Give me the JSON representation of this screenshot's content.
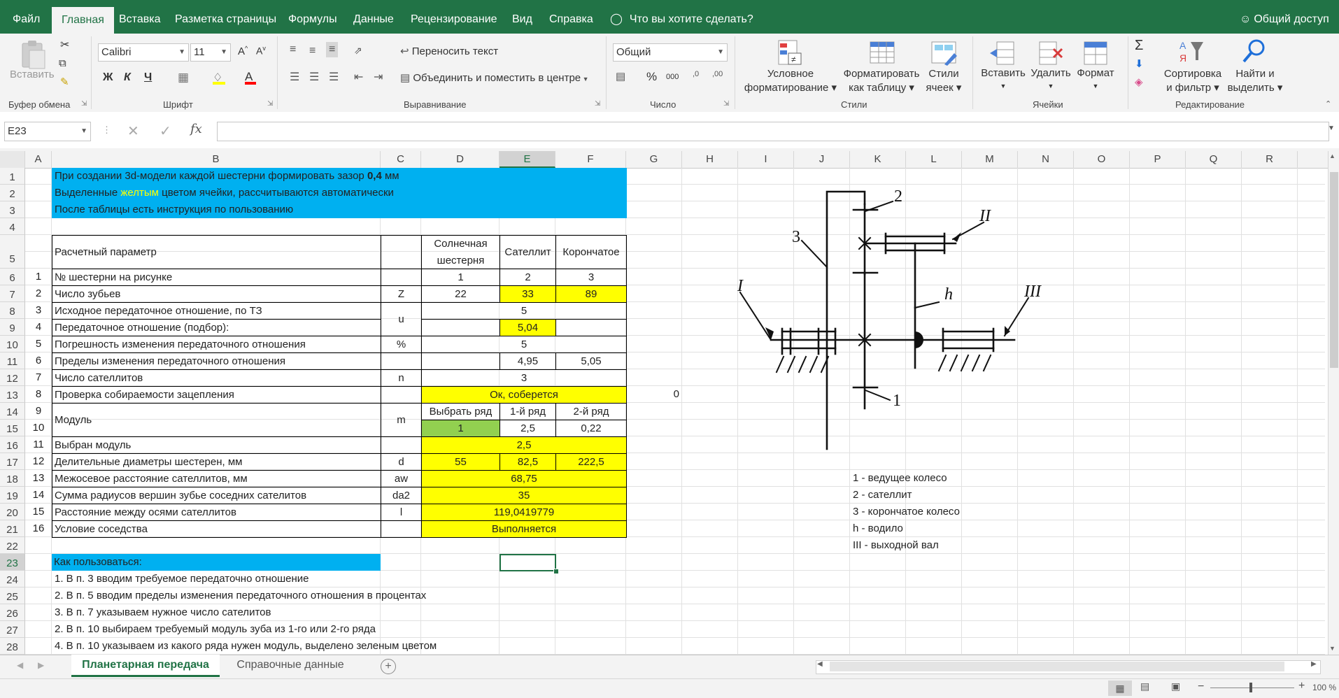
{
  "tabs": [
    "Файл",
    "Главная",
    "Вставка",
    "Разметка страницы",
    "Формулы",
    "Данные",
    "Рецензирование",
    "Вид",
    "Справка"
  ],
  "tell_me": "Что вы хотите сделать?",
  "share": "Общий доступ",
  "ribbon": {
    "clipboard": {
      "paste": "Вставить",
      "label": "Буфер обмена"
    },
    "font": {
      "name": "Calibri",
      "size": "11",
      "bold": "Ж",
      "italic": "К",
      "underline": "Ч",
      "label": "Шрифт"
    },
    "alignment": {
      "wrap": "Переносить текст",
      "merge": "Объединить и поместить в центре",
      "label": "Выравнивание"
    },
    "number": {
      "format": "Общий",
      "percent": "%",
      "thousands": "000",
      "label": "Число"
    },
    "styles": {
      "conditional": [
        "Условное",
        "форматирование"
      ],
      "as_table": [
        "Форматировать",
        "как таблицу"
      ],
      "cell_styles": [
        "Стили",
        "ячеек"
      ],
      "label": "Стили"
    },
    "cells": {
      "insert": "Вставить",
      "delete": "Удалить",
      "format": "Формат",
      "label": "Ячейки"
    },
    "editing": {
      "sum": "Σ",
      "sort": [
        "Сортировка",
        "и фильтр"
      ],
      "find": [
        "Найти и",
        "выделить"
      ],
      "label": "Редактирование"
    }
  },
  "formula_bar": {
    "name_box": "E23",
    "fx": "fx",
    "formula": ""
  },
  "columns": [
    "A",
    "B",
    "C",
    "D",
    "E",
    "F",
    "G",
    "H",
    "I",
    "J",
    "K",
    "L",
    "M",
    "N",
    "O",
    "P",
    "Q",
    "R"
  ],
  "selected_col": "E",
  "selected_row": "23",
  "rows": [
    "1",
    "2",
    "3",
    "4",
    "5",
    "6",
    "7",
    "8",
    "9",
    "10",
    "11",
    "12",
    "13",
    "14",
    "15",
    "16",
    "17",
    "18",
    "19",
    "20",
    "21",
    "22",
    "23",
    "24",
    "25",
    "26",
    "27",
    "28"
  ],
  "info": {
    "line1_pre": "При создании 3d-модели каждой шестерни формировать зазор ",
    "line1_bold": "0,4",
    "line1_post": " мм",
    "line2_pre": "Выделенные ",
    "line2_yellow": "желтым",
    "line2_post": " цветом ячейки, рассчитываются автоматически",
    "line3": "После таблицы есть инструкция по пользованию"
  },
  "table_header": {
    "param": "Расчетный параметр",
    "sun": "Солнечная шестерня",
    "sat": "Сателлит",
    "ring": "Корончатое"
  },
  "table": [
    {
      "n": "1",
      "name": "№ шестерни на рисунке",
      "sym": "",
      "d": "1",
      "e": "2",
      "f": "3"
    },
    {
      "n": "2",
      "name": "Число зубьев",
      "sym": "Z",
      "d": "22",
      "e": "33",
      "f": "89"
    },
    {
      "n": "3",
      "name": "Исходное передаточное отношение, по ТЗ",
      "sym": "u",
      "def": "5"
    },
    {
      "n": "4",
      "name": "Передаточное отношение (подбор):",
      "e": "5,04"
    },
    {
      "n": "5",
      "name": "Погрешность изменения передаточного отношения",
      "sym": "%",
      "def": "5"
    },
    {
      "n": "6",
      "name": "Пределы изменения передаточного отношения",
      "e": "4,95",
      "f": "5,05"
    },
    {
      "n": "7",
      "name": "Число сателлитов",
      "sym": "n",
      "def": "3"
    },
    {
      "n": "8",
      "name": "Проверка собираемости зацепления",
      "def": "Ок, соберется",
      "g": "0"
    },
    {
      "n": "9",
      "name": "Модуль",
      "sym": "m",
      "d": "Выбрать ряд",
      "e": "1-й ряд",
      "f": "2-й ряд"
    },
    {
      "n": "10",
      "d": "1",
      "e": "2,5",
      "f": "0,22"
    },
    {
      "n": "11",
      "name": "Выбран модуль",
      "def": "2,5"
    },
    {
      "n": "12",
      "name": "Делительные диаметры шестерен, мм",
      "sym": "d",
      "d": "55",
      "e": "82,5",
      "f": "222,5"
    },
    {
      "n": "13",
      "name": "Межосевое расстояние сателлитов, мм",
      "sym": "aw",
      "def": "68,75"
    },
    {
      "n": "14",
      "name": "Сумма радиусов вершин зубье соседних сателитов",
      "sym": "da2",
      "def": "35"
    },
    {
      "n": "15",
      "name": "Расстояние между осями сателлитов",
      "sym": "l",
      "def": "119,0419779"
    },
    {
      "n": "16",
      "name": "Условие соседства",
      "def": "Выполняется"
    }
  ],
  "legend": [
    "1 - ведущее колесо",
    "2 - сателлит",
    "3 - корончатое колесо",
    "h - водило",
    "III - выходной вал"
  ],
  "diagram_labels": {
    "l1": "1",
    "l2": "2",
    "l3": "3",
    "I": "I",
    "II": "II",
    "III": "III",
    "h": "h"
  },
  "howto": {
    "title": "Как пользоваться:",
    "steps": [
      "1. В п. 3 вводим требуемое передаточно отношение",
      "2. В п. 5 вводим пределы изменения передаточного отношения в процентах",
      "3. В п. 7 указываем нужное число сателитов",
      "2. В п. 10 выбираем требуемый модуль зуба из 1-го или 2-го ряда",
      "4. В п. 10 указываем из какого ряда нужен модуль, выделено зеленым цветом"
    ]
  },
  "sheets": [
    "Планетарная передача",
    "Справочные данные"
  ],
  "status": {
    "zoom": "100 %"
  },
  "colors": {
    "excel_green": "#217346",
    "info_blue": "#00b0f0",
    "calc_yellow": "#ffff00",
    "choice_green": "#92d050"
  }
}
